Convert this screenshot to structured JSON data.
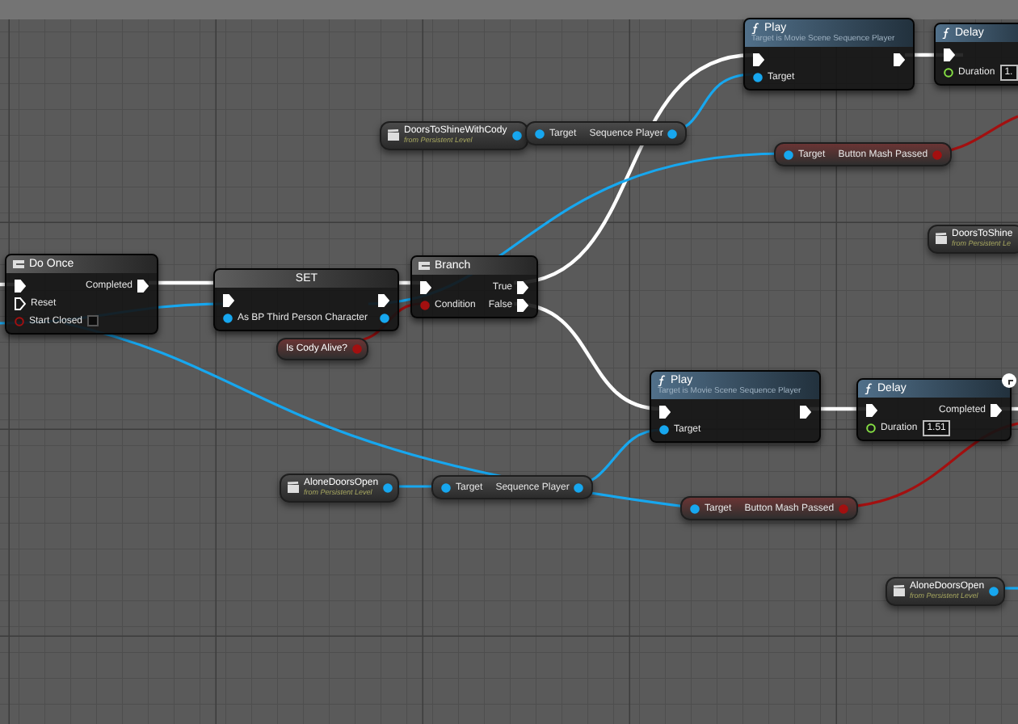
{
  "nodes": [
    {
      "kind": "function",
      "title": "Play",
      "subtitle": "Target is Movie Scene Sequence Player",
      "inputs": [
        {
          "kind": "exec",
          "connected": true
        },
        {
          "kind": "object",
          "label": "Target",
          "connected": true
        }
      ],
      "outputs": [
        {
          "kind": "exec",
          "connected": true
        }
      ]
    },
    {
      "kind": "function",
      "title": "Delay",
      "inputs": [
        {
          "kind": "exec",
          "connected": true
        },
        {
          "kind": "float",
          "label": "Duration",
          "connected": false,
          "value": "1."
        }
      ]
    },
    {
      "kind": "reference",
      "title": "DoorsToShineWithCody",
      "subtitle": "from Persistent Level",
      "outputs": [
        {
          "kind": "object",
          "connected": true
        }
      ]
    },
    {
      "kind": "compact",
      "inputs": [
        {
          "kind": "object",
          "label": "Target",
          "connected": true
        }
      ],
      "outputs": [
        {
          "kind": "object",
          "label": "Sequence Player",
          "connected": true
        }
      ]
    },
    {
      "kind": "compact",
      "inputs": [
        {
          "kind": "object",
          "label": "Target",
          "connected": true
        }
      ],
      "outputs": [
        {
          "kind": "bool",
          "label": "Button Mash Passed",
          "connected": true
        }
      ]
    },
    {
      "kind": "reference",
      "title": "DoorsToShine",
      "subtitle": "from Persistent Le"
    },
    {
      "kind": "flow",
      "title": "Do Once",
      "inputs": [
        {
          "kind": "exec",
          "connected": true
        },
        {
          "kind": "exec",
          "label": "Reset",
          "connected": false
        },
        {
          "kind": "bool",
          "label": "Start Closed",
          "connected": false,
          "checked": false
        }
      ],
      "outputs": [
        {
          "kind": "exec",
          "label": "Completed",
          "connected": true
        }
      ]
    },
    {
      "kind": "set",
      "title": "SET",
      "inputs": [
        {
          "kind": "exec",
          "connected": true
        },
        {
          "kind": "object",
          "label": "As BP Third Person Character",
          "connected": true
        }
      ],
      "outputs": [
        {
          "kind": "exec",
          "connected": true
        },
        {
          "kind": "object",
          "connected": true
        }
      ]
    },
    {
      "kind": "flow",
      "title": "Branch",
      "inputs": [
        {
          "kind": "exec",
          "connected": true
        },
        {
          "kind": "bool",
          "label": "Condition",
          "connected": true
        }
      ],
      "outputs": [
        {
          "kind": "exec",
          "label": "True",
          "connected": true
        },
        {
          "kind": "exec",
          "label": "False",
          "connected": true
        }
      ]
    },
    {
      "kind": "variable",
      "title": "Is Cody Alive?",
      "outputs": [
        {
          "kind": "bool",
          "connected": true
        }
      ]
    },
    {
      "kind": "function",
      "title": "Play",
      "subtitle": "Target is Movie Scene Sequence Player",
      "inputs": [
        {
          "kind": "exec",
          "connected": true
        },
        {
          "kind": "object",
          "label": "Target",
          "connected": true
        }
      ],
      "outputs": [
        {
          "kind": "exec",
          "connected": true
        }
      ]
    },
    {
      "kind": "function",
      "title": "Delay",
      "latent": true,
      "inputs": [
        {
          "kind": "exec",
          "connected": true
        },
        {
          "kind": "float",
          "label": "Duration",
          "connected": false,
          "value": "1.51"
        }
      ],
      "outputs": [
        {
          "kind": "exec",
          "label": "Completed",
          "connected": true
        }
      ]
    },
    {
      "kind": "reference",
      "title": "AloneDoorsOpen",
      "subtitle": "from Persistent Level",
      "outputs": [
        {
          "kind": "object",
          "connected": true
        }
      ]
    },
    {
      "kind": "compact",
      "inputs": [
        {
          "kind": "object",
          "label": "Target",
          "connected": true
        }
      ],
      "outputs": [
        {
          "kind": "object",
          "label": "Sequence Player",
          "connected": true
        }
      ]
    },
    {
      "kind": "compact",
      "inputs": [
        {
          "kind": "object",
          "label": "Target",
          "connected": true
        }
      ],
      "outputs": [
        {
          "kind": "bool",
          "label": "Button Mash Passed",
          "connected": true
        }
      ]
    },
    {
      "kind": "reference",
      "title": "AloneDoorsOpen",
      "subtitle": "from Persistent Level",
      "outputs": [
        {
          "kind": "object",
          "connected": true
        }
      ]
    }
  ]
}
